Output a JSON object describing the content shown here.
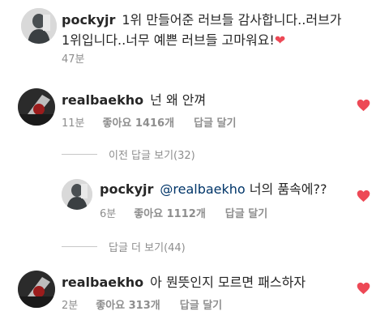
{
  "caption": {
    "username": "pockyjr",
    "text_line1": "1위 만들어준 러브들 감사합니다..러브가",
    "text_line2": "1위입니다..너무 예쁜 러브들 고마워요!",
    "emoji": "❤",
    "time": "47분"
  },
  "comments": [
    {
      "username": "realbaekho",
      "text": "넌 왜 안껴",
      "time": "11분",
      "likes": "좋아요 1416개",
      "reply_label": "답글 달기",
      "like_icon": "heart-filled-icon"
    }
  ],
  "previous_replies_toggle": "이전 답글 보기(32)",
  "reply": {
    "username": "pockyjr",
    "mention": "@realbaekho",
    "text": "너의 품속에??",
    "time": "6분",
    "likes": "좋아요 1112개",
    "reply_label": "답글 달기",
    "like_icon": "heart-filled-icon"
  },
  "more_replies_toggle": "답글 더 보기(44)",
  "comment2": {
    "username": "realbaekho",
    "text": "아 뭔뜻인지 모르면 패스하자",
    "time": "2분",
    "likes": "좋아요 313개",
    "reply_label": "답글 달기",
    "like_icon": "heart-filled-icon"
  },
  "colors": {
    "heart": "#ed4956",
    "meta_text": "#8e8e8e",
    "mention": "#003569"
  }
}
